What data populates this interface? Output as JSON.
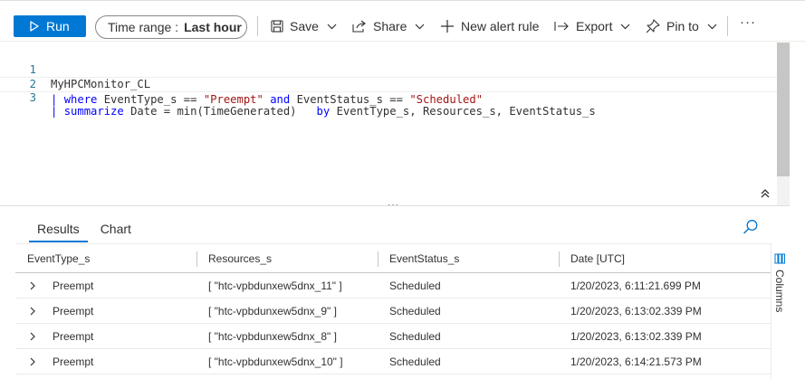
{
  "toolbar": {
    "run_label": "Run",
    "time_range_label": "Time range :",
    "time_range_value": "Last hour",
    "save_label": "Save",
    "share_label": "Share",
    "new_alert_label": "New alert rule",
    "export_label": "Export",
    "pin_label": "Pin to",
    "more_label": "···"
  },
  "editor": {
    "lines": [
      {
        "num": "1"
      },
      {
        "num": "2"
      },
      {
        "num": "3"
      }
    ],
    "line1": {
      "table": "MyHPCMonitor_CL"
    },
    "line2": {
      "pipe": "|",
      "kw_where": "where",
      "field1": "EventType_s",
      "op1": "==",
      "val1": "\"Preempt\"",
      "kw_and": "and",
      "field2": "EventStatus_s",
      "op2": "==",
      "val2": "\"Scheduled\""
    },
    "line3": {
      "pipe": "|",
      "kw_summarize": "summarize",
      "expr": "Date = min(TimeGenerated)",
      "kw_by": "by",
      "group": "EventType_s, Resources_s, EventStatus_s"
    },
    "resize_handle": "···"
  },
  "results": {
    "tabs": [
      {
        "label": "Results",
        "selected": true
      },
      {
        "label": "Chart",
        "selected": false
      }
    ],
    "columns": [
      "EventType_s",
      "Resources_s",
      "EventStatus_s",
      "Date [UTC]"
    ],
    "rows": [
      [
        "Preempt",
        "[ \"htc-vpbdunxew5dnx_11\" ]",
        "Scheduled",
        "1/20/2023, 6:11:21.699 PM"
      ],
      [
        "Preempt",
        "[ \"htc-vpbdunxew5dnx_9\" ]",
        "Scheduled",
        "1/20/2023, 6:13:02.339 PM"
      ],
      [
        "Preempt",
        "[ \"htc-vpbdunxew5dnx_8\" ]",
        "Scheduled",
        "1/20/2023, 6:13:02.339 PM"
      ],
      [
        "Preempt",
        "[ \"htc-vpbdunxew5dnx_10\" ]",
        "Scheduled",
        "1/20/2023, 6:14:21.573 PM"
      ]
    ],
    "columns_panel_label": "Columns"
  },
  "colors": {
    "accent": "#0078d4",
    "keyword": "#0000ff",
    "string": "#a31515",
    "line_number": "#237893"
  },
  "icons": [
    "play-icon",
    "save-icon",
    "share-icon",
    "plus-icon",
    "export-icon",
    "pin-icon",
    "chevron-down-icon",
    "collapse-up-icon",
    "search-icon",
    "chevron-right-icon",
    "columns-icon"
  ]
}
